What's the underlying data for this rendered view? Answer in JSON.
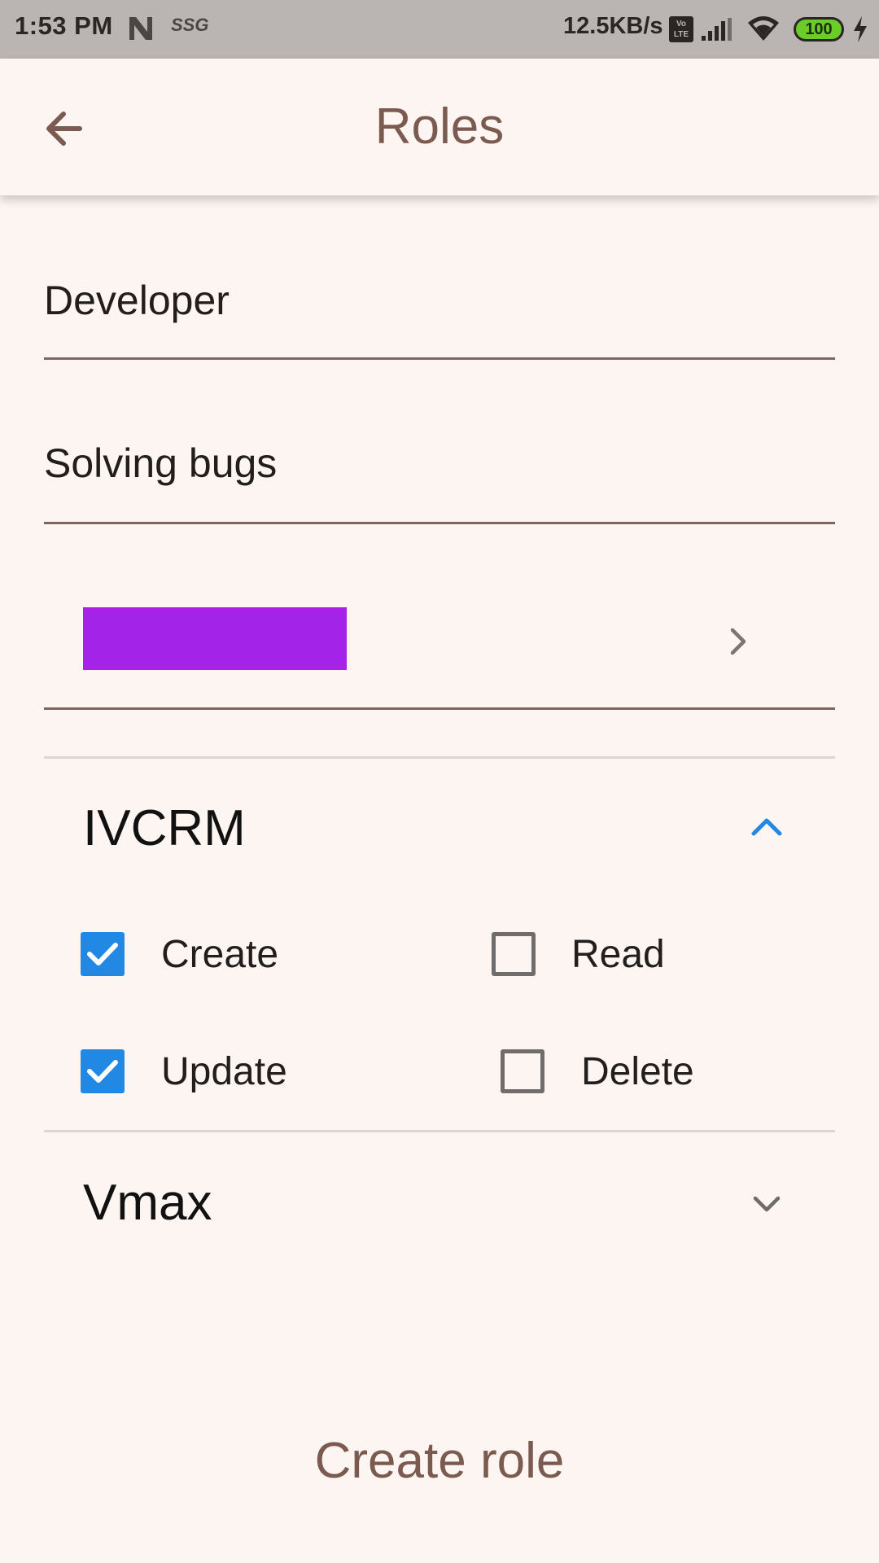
{
  "status_bar": {
    "time": "1:53 PM",
    "carrier_tag": "SSG",
    "net_speed": "12.5KB/s",
    "volte": "Vo LTE",
    "battery": "100"
  },
  "app_bar": {
    "title": "Roles",
    "back_icon": "arrow-back-icon"
  },
  "form": {
    "role_name": "Developer",
    "role_description": "Solving bugs",
    "color": "#a423e8"
  },
  "sections": [
    {
      "title": "IVCRM",
      "expanded": true,
      "permissions": [
        {
          "label": "Create",
          "checked": true
        },
        {
          "label": "Read",
          "checked": false
        },
        {
          "label": "Update",
          "checked": true
        },
        {
          "label": "Delete",
          "checked": false
        }
      ]
    },
    {
      "title": "Vmax",
      "expanded": false
    }
  ],
  "actions": {
    "create_label": "Create role"
  },
  "colors": {
    "accent_blue": "#2188e4",
    "title_brown": "#7b5a4f",
    "background": "#fcf5f2"
  }
}
